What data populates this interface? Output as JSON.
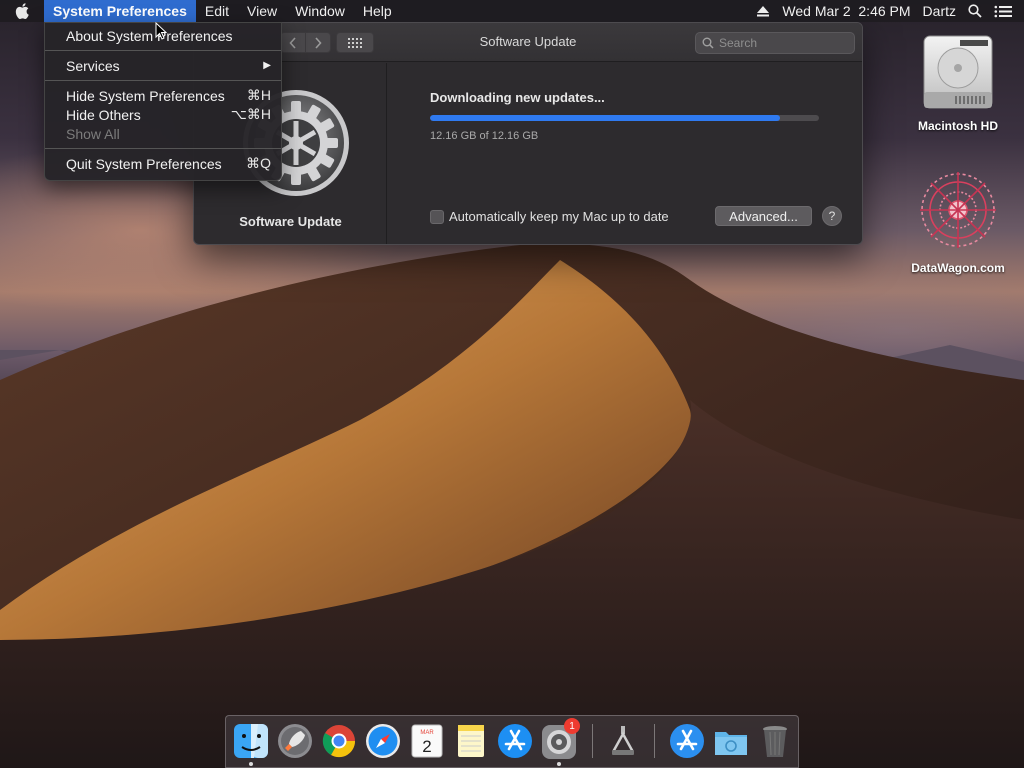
{
  "menubar": {
    "app_name": "System Preferences",
    "menus": [
      "Edit",
      "View",
      "Window",
      "Help"
    ],
    "clock": "Wed Mar 2  2:46 PM",
    "user": "Dartz"
  },
  "app_menu": {
    "items": [
      {
        "label": "About System Preferences",
        "shortcut": ""
      },
      {
        "label": "Services",
        "shortcut": "▶"
      },
      {
        "label": "Hide System Preferences",
        "shortcut": "⌘H"
      },
      {
        "label": "Hide Others",
        "shortcut": "⌥⌘H"
      },
      {
        "label": "Show All",
        "shortcut": "",
        "disabled": true
      },
      {
        "label": "Quit System Preferences",
        "shortcut": "⌘Q"
      }
    ]
  },
  "window": {
    "title": "Software Update",
    "search_placeholder": "Search",
    "sidebar_label": "Software Update",
    "status": "Downloading new updates...",
    "progress_fraction": 0.9,
    "size_text": "12.16 GB of 12.16 GB",
    "auto_update_label": "Automatically keep my Mac up to date",
    "advanced_label": "Advanced...",
    "help_label": "?"
  },
  "desktop": {
    "icons": [
      {
        "label": "Macintosh HD",
        "icon": "hard-drive-icon"
      },
      {
        "label": "DataWagon.com",
        "icon": "mandala-icon"
      }
    ]
  },
  "dock": {
    "items": [
      "Finder",
      "Launchpad",
      "Google Chrome",
      "Safari",
      "Calendar",
      "Notes",
      "App Store",
      "System Preferences",
      "Archive Utility",
      "Applications",
      "Downloads",
      "Trash"
    ],
    "calendar": {
      "month": "MAR",
      "day": "2"
    },
    "sysprefs_badge": "1",
    "colors": {
      "accent": "#2f6ccf",
      "progress": "#2f7af0"
    }
  }
}
